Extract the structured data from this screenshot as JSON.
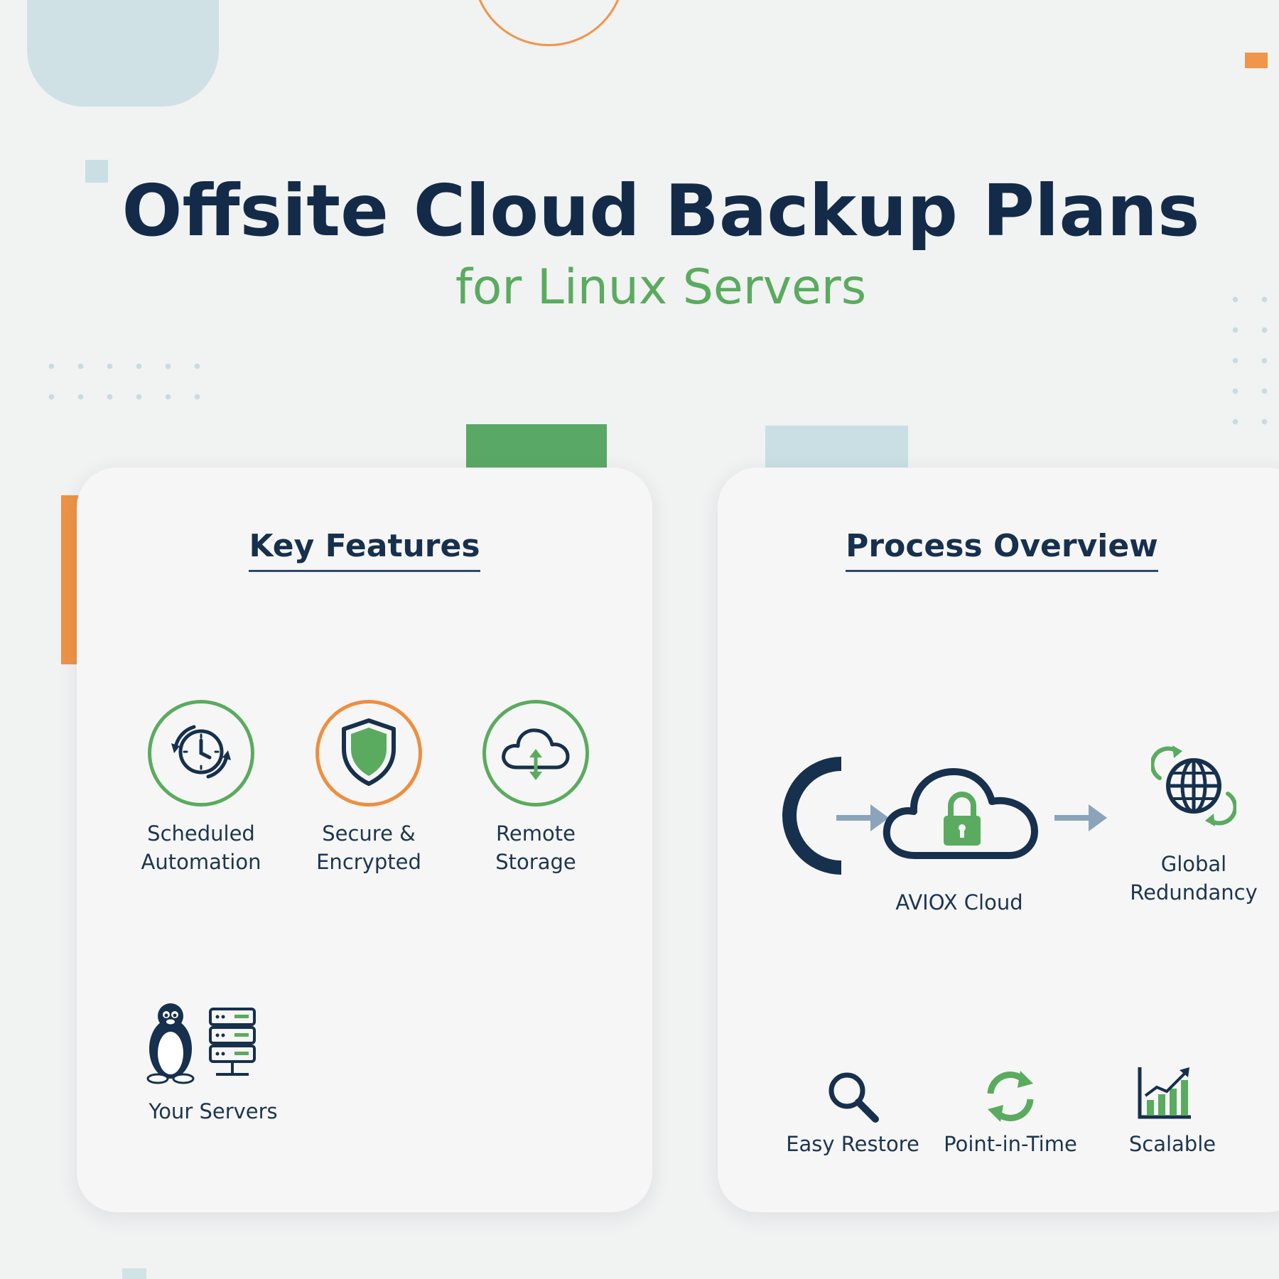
{
  "header": {
    "title": "Offsite Cloud Backup Plans",
    "subtitle": "for Linux Servers"
  },
  "key_features": {
    "heading": "Key Features",
    "features": [
      {
        "line1": "Scheduled",
        "line2": "Automation",
        "icon": "clock-sync-icon",
        "ring_color": "#5aab5f"
      },
      {
        "line1": "Secure &",
        "line2": "Encrypted",
        "icon": "shield-icon",
        "ring_color": "#ef8e3f"
      },
      {
        "line1": "Remote",
        "line2": "Storage",
        "icon": "cloud-transfer-icon",
        "ring_color": "#5aab5f"
      }
    ],
    "servers": {
      "label": "Your Servers",
      "icon": "linux-server-icon"
    }
  },
  "process_overview": {
    "heading": "Process Overview",
    "flow": {
      "cloud_label": "AVIOX Cloud",
      "redundancy_line1": "Global",
      "redundancy_line2": "Redundancy"
    },
    "benefits": [
      {
        "label": "Easy Restore",
        "icon": "magnifier-icon"
      },
      {
        "label": "Point-in-Time",
        "icon": "refresh-icon"
      },
      {
        "label": "Scalable",
        "icon": "bar-chart-icon"
      }
    ]
  },
  "colors": {
    "navy": "#132b49",
    "green": "#5aab5f",
    "orange": "#ef8e3f",
    "light_blue": "#c9dfe3",
    "background": "#f1f2f2"
  }
}
